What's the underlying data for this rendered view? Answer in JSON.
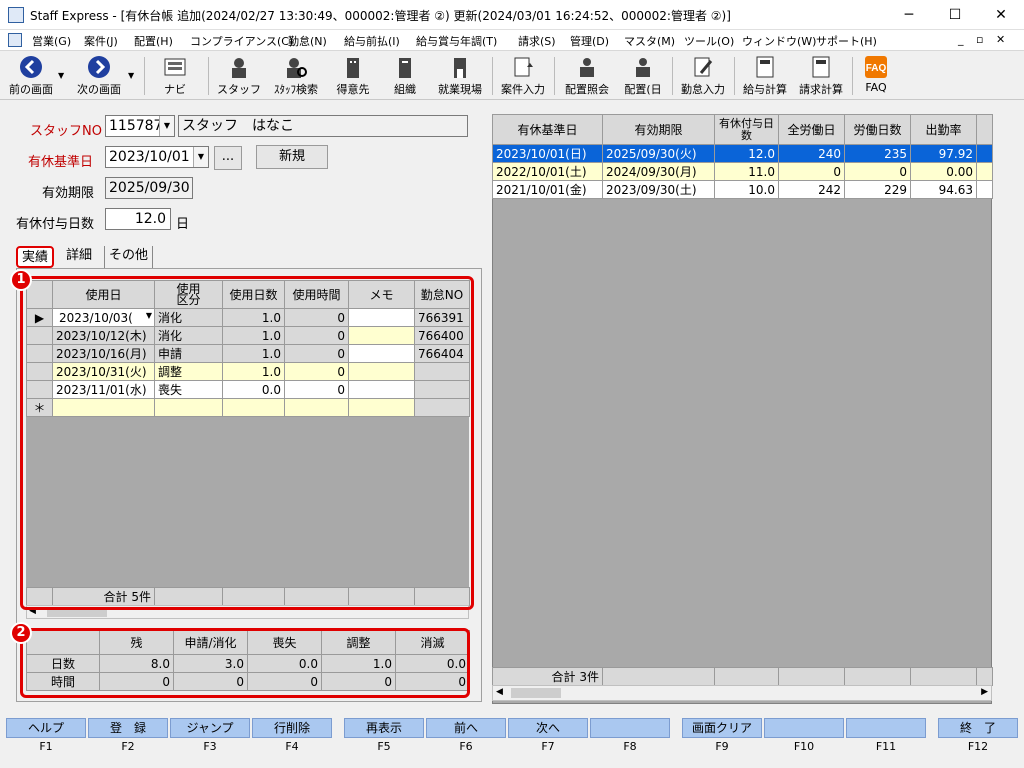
{
  "window": {
    "title": "Staff Express - [有休台帳 追加(2024/02/27 13:30:49、000002:管理者 ②) 更新(2024/03/01 16:24:52、000002:管理者 ②)]",
    "min": "─",
    "max": "☐",
    "close": "✕"
  },
  "menu": [
    "営業(G)",
    "案件(J)",
    "配置(H)",
    "コンプライアンス(C)",
    "勤怠(N)",
    "給与前払(I)",
    "給与賞与年調(T)",
    "請求(S)",
    "管理(D)",
    "マスタ(M)",
    "ツール(O)",
    "ウィンドウ(W)",
    "サポート(H)"
  ],
  "mdi_controls": [
    "_",
    "▫",
    "✕"
  ],
  "toolbar": [
    "前の画面",
    "次の画面",
    "ナビ",
    "スタッフ",
    "ｽﾀｯﾌ検索",
    "得意先",
    "組織",
    "就業現場",
    "案件入力",
    "配置照会",
    "配置(日",
    "勤怠入力",
    "給与計算",
    "請求計算",
    "FAQ"
  ],
  "form": {
    "staff_no_label": "スタッフNO",
    "staff_no": "115787",
    "staff_name": "スタッフ　はなこ",
    "base_date_label": "有休基準日",
    "base_date": "2023/10/01",
    "ellipsis": "...",
    "new_btn": "新規",
    "expiry_label": "有効期限",
    "expiry": "2025/09/30",
    "grant_days_label": "有休付与日数",
    "grant_days": "12.0",
    "day_unit": "日"
  },
  "tabs": [
    "実績",
    "詳細",
    "その他"
  ],
  "usage_grid": {
    "headers": [
      "使用日",
      "使用\n区分",
      "使用日数",
      "使用時間",
      "メモ",
      "勤怠NO"
    ],
    "rows": [
      [
        "2023/10/03(",
        "消化",
        "1.0",
        "0",
        "",
        "766391"
      ],
      [
        "2023/10/12(木)",
        "消化",
        "1.0",
        "0",
        "",
        "766400"
      ],
      [
        "2023/10/16(月)",
        "申請",
        "1.0",
        "0",
        "",
        "766404"
      ],
      [
        "2023/10/31(火)",
        "調整",
        "1.0",
        "0",
        "",
        ""
      ],
      [
        "2023/11/01(水)",
        "喪失",
        "0.0",
        "0",
        "",
        ""
      ]
    ],
    "new_row_marker": "＊",
    "current_marker": "▶",
    "total": "合計 5件"
  },
  "summary_grid": {
    "headers": [
      "残",
      "申請/消化",
      "喪失",
      "調整",
      "消滅"
    ],
    "rows": [
      {
        "label": "日数",
        "values": [
          "8.0",
          "3.0",
          "0.0",
          "1.0",
          "0.0"
        ]
      },
      {
        "label": "時間",
        "values": [
          "0",
          "0",
          "0",
          "0",
          "0"
        ]
      }
    ]
  },
  "badges": [
    "1",
    "2"
  ],
  "history_grid": {
    "headers": [
      "有休基準日",
      "有効期限",
      "有休付与日数",
      "全労働日",
      "労働日数",
      "出勤率"
    ],
    "rows": [
      [
        "2023/10/01(日)",
        "2025/09/30(火)",
        "12.0",
        "240",
        "235",
        "97.92"
      ],
      [
        "2022/10/01(土)",
        "2024/09/30(月)",
        "11.0",
        "0",
        "0",
        "0.00"
      ],
      [
        "2021/10/01(金)",
        "2023/09/30(土)",
        "10.0",
        "242",
        "229",
        "94.63"
      ]
    ],
    "total": "合計 3件"
  },
  "fkeys": [
    {
      "label": "ヘルプ",
      "key": "F1"
    },
    {
      "label": "登　録",
      "key": "F2"
    },
    {
      "label": "ジャンプ",
      "key": "F3"
    },
    {
      "label": "行削除",
      "key": "F4"
    },
    {
      "label": "再表示",
      "key": "F5"
    },
    {
      "label": "前へ",
      "key": "F6"
    },
    {
      "label": "次へ",
      "key": "F7"
    },
    {
      "label": "",
      "key": "F8"
    },
    {
      "label": "画面クリア",
      "key": "F9"
    },
    {
      "label": "",
      "key": "F10"
    },
    {
      "label": "",
      "key": "F11"
    },
    {
      "label": "終　了",
      "key": "F12"
    }
  ],
  "colors": {
    "accent": "#e00000",
    "selection": "#0a64d8",
    "fkey": "#aac8f0",
    "editable": "#ffffd0"
  }
}
